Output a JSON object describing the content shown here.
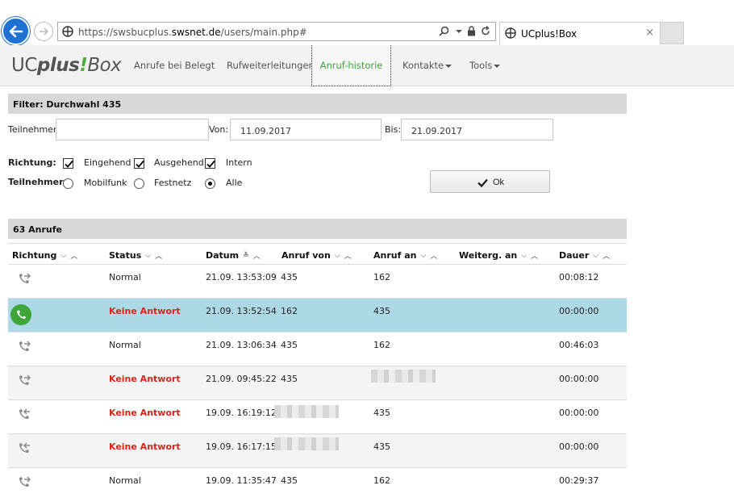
{
  "browser": {
    "url_prefix": "https://swsbucplus.",
    "url_domain": "swsnet.de",
    "url_path": "/users/main.php#",
    "tab_title": "UCplus!Box",
    "tab_close": "×"
  },
  "logo": {
    "uc": "UC",
    "plus": "plus",
    "excl": "!",
    "box": "Box"
  },
  "nav": {
    "items": [
      {
        "label": "Anrufe bei Belegt"
      },
      {
        "label": "Rufweiterleitungen"
      },
      {
        "label": "Anruf-historie",
        "active": true
      },
      {
        "label": "Kontakte"
      },
      {
        "label": "Tools"
      }
    ]
  },
  "filter": {
    "heading": "Filter: Durchwahl 435",
    "teilnehmer_label": "Teilnehmer:",
    "teilnehmer_value": "",
    "von_label": "Von:",
    "von_value": "11.09.2017",
    "bis_label": "Bis:",
    "bis_value": "21.09.2017",
    "richtung_label": "Richtung:",
    "richtung_options": [
      {
        "label": "Eingehend",
        "checked": true
      },
      {
        "label": "Ausgehend",
        "checked": true
      },
      {
        "label": "Intern",
        "checked": true
      }
    ],
    "teilnehmer_type_label": "Teilnehmer:",
    "teilnehmer_types": [
      {
        "label": "Mobilfunk",
        "selected": false
      },
      {
        "label": "Festnetz",
        "selected": false
      },
      {
        "label": "Alle",
        "selected": true
      }
    ],
    "ok_label": "Ok"
  },
  "calls": {
    "heading": "63 Anrufe",
    "columns": [
      "Richtung",
      "Status",
      "Datum",
      "Anruf von",
      "Anruf an",
      "Weiterg. an",
      "Dauer"
    ],
    "rows": [
      {
        "direction": "outgoing",
        "status": "Normal",
        "missed": false,
        "datum": "21.09. 13:53:09",
        "von": "435",
        "an": "162",
        "weiterg": "",
        "dauer": "00:08:12"
      },
      {
        "direction": "incoming-missed",
        "status": "Keine Antwort",
        "missed": true,
        "datum": "21.09. 13:52:54",
        "von": "162",
        "an": "435",
        "weiterg": "",
        "dauer": "00:00:00",
        "selected": true
      },
      {
        "direction": "outgoing",
        "status": "Normal",
        "missed": false,
        "datum": "21.09. 13:06:34",
        "von": "435",
        "an": "162",
        "weiterg": "",
        "dauer": "00:46:03"
      },
      {
        "direction": "outgoing",
        "status": "Keine Antwort",
        "missed": true,
        "datum": "21.09. 09:45:22",
        "von": "435",
        "an": "",
        "weiterg": "",
        "dauer": "00:00:00",
        "an_redacted": true
      },
      {
        "direction": "incoming",
        "status": "Keine Antwort",
        "missed": true,
        "datum": "19.09. 16:19:12",
        "von": "",
        "an": "435",
        "weiterg": "",
        "dauer": "00:00:00",
        "von_redacted": true
      },
      {
        "direction": "incoming",
        "status": "Keine Antwort",
        "missed": true,
        "datum": "19.09. 16:17:15",
        "von": "",
        "an": "435",
        "weiterg": "",
        "dauer": "00:00:00",
        "von_redacted": true
      },
      {
        "direction": "outgoing",
        "status": "Normal",
        "missed": false,
        "datum": "19.09. 11:35:47",
        "von": "435",
        "an": "162",
        "weiterg": "",
        "dauer": "00:29:37"
      }
    ]
  },
  "colors": {
    "accent_green": "#3aa635",
    "missed_red": "#d9261c",
    "selected_row": "#add8e6"
  }
}
